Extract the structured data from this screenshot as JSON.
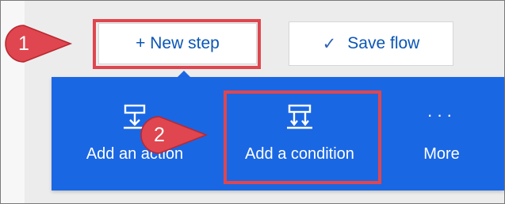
{
  "toolbar": {
    "new_step_label": "+ New step",
    "save_flow_label": "Save flow",
    "check_icon": "✓"
  },
  "menu": {
    "items": [
      {
        "label": "Add an action",
        "icon": "add-action-icon"
      },
      {
        "label": "Add a condition",
        "icon": "add-condition-icon"
      },
      {
        "label": "More",
        "icon": "more-icon"
      }
    ]
  },
  "annotations": {
    "step1": "1",
    "step2": "2"
  },
  "colors": {
    "panel_blue": "#1a67e3",
    "link_blue": "#0a56b6",
    "highlight_red": "#e0464f"
  }
}
